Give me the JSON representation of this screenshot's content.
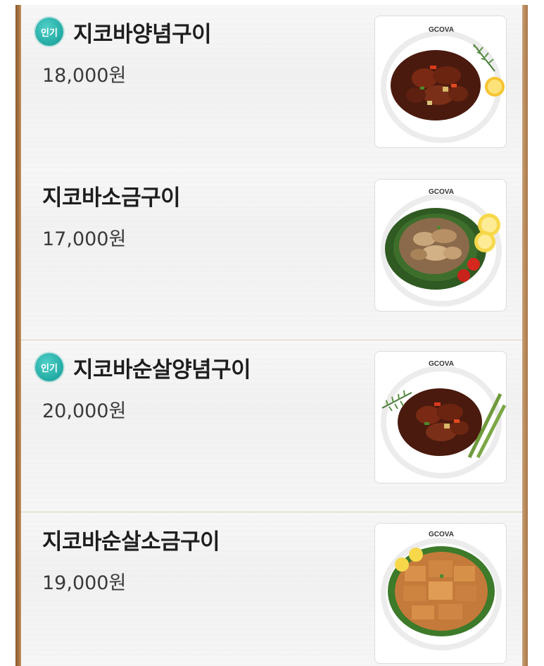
{
  "badge_label": "인기",
  "colors": {
    "badge": "#22aaa3",
    "rail": "#a87444",
    "divider": "#d9cbb7"
  },
  "items": [
    {
      "name": "지코바양념구이",
      "price": "18,000원",
      "popular": true,
      "photo": {
        "brand": "GCOVA",
        "dish": "yangnyeom-chicken-icon",
        "garnish": "rosemary-lemon"
      }
    },
    {
      "name": "지코바소금구이",
      "price": "17,000원",
      "popular": false,
      "photo": {
        "brand": "GCOVA",
        "dish": "salt-chicken-icon",
        "garnish": "lettuce-lemon-tomato"
      }
    },
    {
      "name": "지코바순살양념구이",
      "price": "20,000원",
      "popular": true,
      "photo": {
        "brand": "GCOVA",
        "dish": "boneless-yangnyeom-chicken-icon",
        "garnish": "rosemary-asparagus"
      }
    },
    {
      "name": "지코바순살소금구이",
      "price": "19,000원",
      "popular": false,
      "photo": {
        "brand": "GCOVA",
        "dish": "boneless-salt-chicken-icon",
        "garnish": "lettuce-lemon"
      }
    }
  ]
}
